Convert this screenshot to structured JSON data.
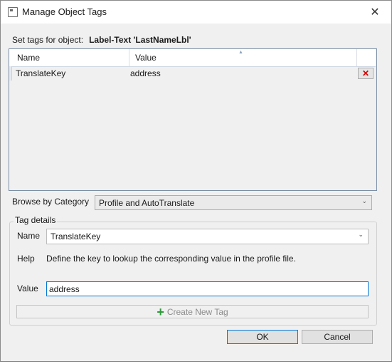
{
  "window": {
    "title": "Manage Object Tags",
    "close_glyph": "✕"
  },
  "header": {
    "label": "Set tags for object:",
    "object": "Label-Text  'LastNameLbl'"
  },
  "grid": {
    "columns": [
      "Name",
      "Value"
    ],
    "sort_glyph": "▲",
    "rows": [
      {
        "name": "TranslateKey",
        "value": "address",
        "delete_glyph": "✕"
      }
    ]
  },
  "browse": {
    "label": "Browse by Category",
    "selected": "Profile and AutoTranslate",
    "chevron": "⌄"
  },
  "tag_details": {
    "group_label": "Tag details",
    "name_label": "Name",
    "name_value": "TranslateKey",
    "help_label": "Help",
    "help_text": "Define the key to lookup the corresponding value in the profile file.",
    "value_label": "Value",
    "value_text": "address",
    "create_plus": "+",
    "create_label": "Create New Tag"
  },
  "buttons": {
    "ok": "OK",
    "cancel": "Cancel"
  },
  "icons": {
    "app": "window-icon",
    "close": "close-icon",
    "delete": "delete-x-icon",
    "plus": "plus-icon"
  },
  "colors": {
    "accent": "#0078d7",
    "delete": "#d40000",
    "plus": "#2e9a3a"
  }
}
